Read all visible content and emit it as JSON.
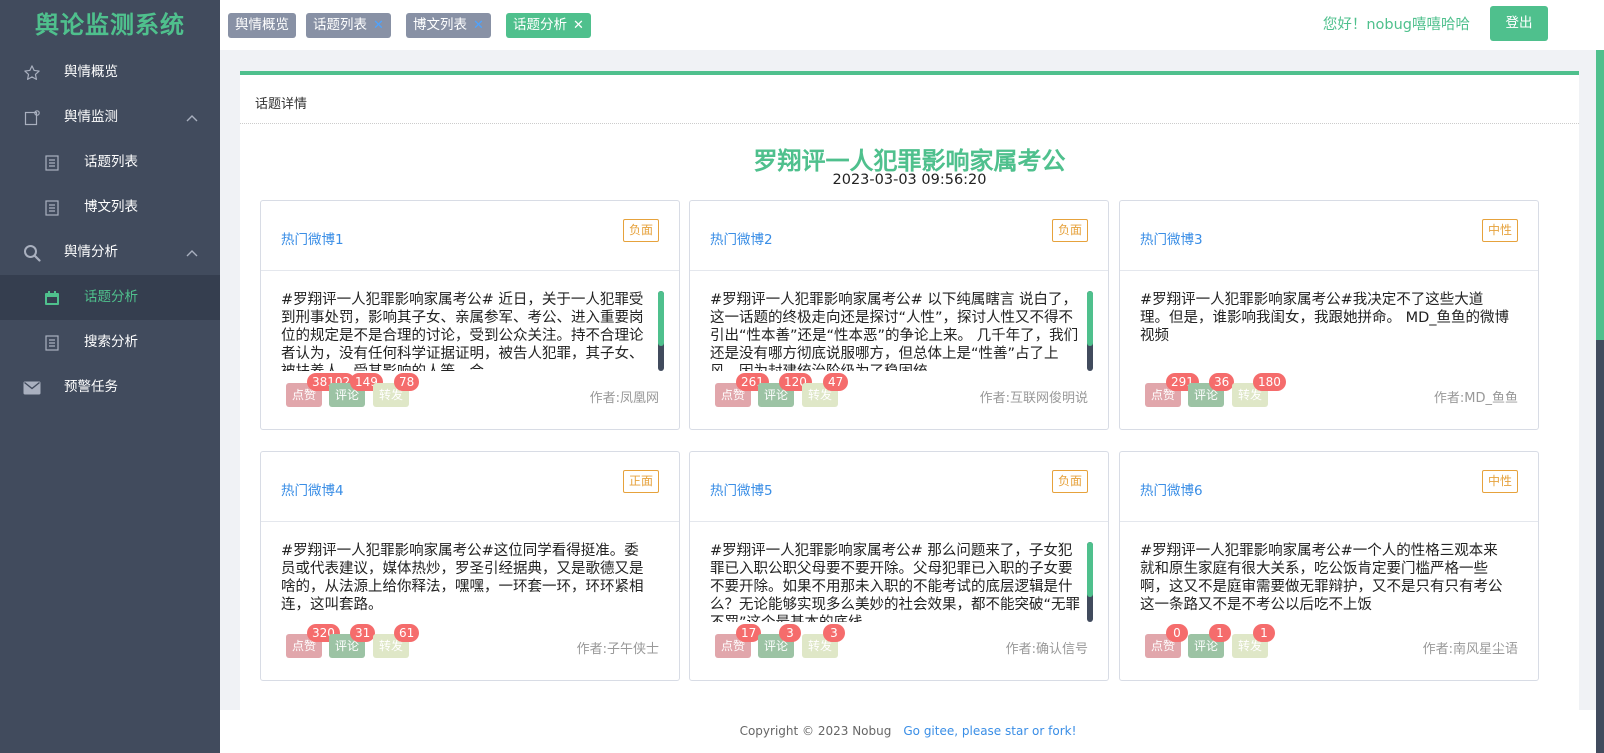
{
  "sidebar": {
    "logo": "舆论监测系统",
    "items": [
      {
        "label": "舆情概览",
        "icon": "star-icon"
      },
      {
        "label": "舆情监测",
        "icon": "monitor-icon",
        "expanded": true
      },
      {
        "label": "话题列表",
        "icon": "document-icon"
      },
      {
        "label": "博文列表",
        "icon": "document-icon"
      },
      {
        "label": "舆情分析",
        "icon": "search-icon",
        "expanded": true
      },
      {
        "label": "话题分析",
        "icon": "calendar-icon",
        "active": true
      },
      {
        "label": "搜索分析",
        "icon": "document-icon"
      },
      {
        "label": "预警任务",
        "icon": "mail-icon"
      }
    ]
  },
  "header": {
    "tabs": [
      {
        "label": "舆情概览",
        "closable": false
      },
      {
        "label": "话题列表",
        "closable": true
      },
      {
        "label": "博文列表",
        "closable": true
      },
      {
        "label": "话题分析",
        "closable": true,
        "active": true
      }
    ],
    "close_glyph": "✕",
    "greeting": "您好！nobug嘻嘻哈哈",
    "logout_label": "登出"
  },
  "panel": {
    "title": "话题详情",
    "topic_title": "罗翔评一人犯罪影响家属考公",
    "topic_time": "2023-03-03 09:56:20"
  },
  "stat_labels": {
    "like": "点赞",
    "comment": "评论",
    "share": "转发"
  },
  "cards": [
    {
      "name": "热门微博1",
      "sentiment": "负面",
      "text": "#罗翔评一人犯罪影响家属考公# 近日，关于一人犯罪受到刑事处罚，影响其子女、亲属参军、考公、进入重要岗位的规定是不是合理的讨论，受到公众关注。持不合理论者认为，没有任何科学证据证明，被告人犯罪，其子女、被扶养人、受其影响的人等，会",
      "likes": "38102",
      "comments": "149",
      "shares": "78",
      "author": "作者:凤凰网",
      "scroll": true
    },
    {
      "name": "热门微博2",
      "sentiment": "负面",
      "text": "#罗翔评一人犯罪影响家属考公# 以下纯属瞎言 说白了，这一话题的终极走向还是探讨“人性”，探讨人性又不得不引出“性本善”还是“性本恶”的争论上来。 几千年了，我们还是没有哪方彻底说服哪方，但总体上是“性善”占了上风，因为封建统治阶级为了稳固统",
      "likes": "261",
      "comments": "120",
      "shares": "47",
      "author": "作者:互联网俊明说",
      "scroll": true
    },
    {
      "name": "热门微博3",
      "sentiment": "中性",
      "text": "#罗翔评一人犯罪影响家属考公#我决定不了这些大道理。但是，谁影响我闺女，我跟她拼命。 MD_鱼鱼的微博视频",
      "likes": "291",
      "comments": "36",
      "shares": "180",
      "author": "作者:MD_鱼鱼",
      "scroll": false
    },
    {
      "name": "热门微博4",
      "sentiment": "正面",
      "text": "#罗翔评一人犯罪影响家属考公#这位同学看得挺准。委员或代表建议，媒体热炒，罗圣引经据典，又是歌德又是啥的，从法源上给你释法，嘿嘿，一环套一环，环环紧相连，这叫套路。",
      "likes": "320",
      "comments": "31",
      "shares": "61",
      "author": "作者:子午侠士",
      "scroll": false
    },
    {
      "name": "热门微博5",
      "sentiment": "负面",
      "text": "#罗翔评一人犯罪影响家属考公# 那么问题来了，子女犯罪已入职公职父母要不要开除。父母犯罪已入职的子女要不要开除。如果不用那未入职的不能考试的底层逻辑是什么？无论能够实现多么美妙的社会效果，都不能突破“无罪不罚”这个最基本的底线。",
      "likes": "17",
      "comments": "3",
      "shares": "3",
      "author": "作者:确认信号",
      "scroll": true
    },
    {
      "name": "热门微博6",
      "sentiment": "中性",
      "text": "#罗翔评一人犯罪影响家属考公#一个人的性格三观本来就和原生家庭有很大关系，吃公饭肯定要门槛严格一些啊，这又不是庭审需要做无罪辩护，又不是只有只有考公这一条路又不是不考公以后吃不上饭",
      "likes": "0",
      "comments": "1",
      "shares": "1",
      "author": "作者:南风星尘语",
      "scroll": false
    }
  ],
  "footer": {
    "copyright": "Copyright © 2023 Nobug",
    "link": "Go gitee, please star or fork!"
  },
  "colors": {
    "accent": "#4fc08d",
    "sidebar": "#414b5d",
    "badge": "#f56c6c",
    "link": "#3a8ee6"
  }
}
